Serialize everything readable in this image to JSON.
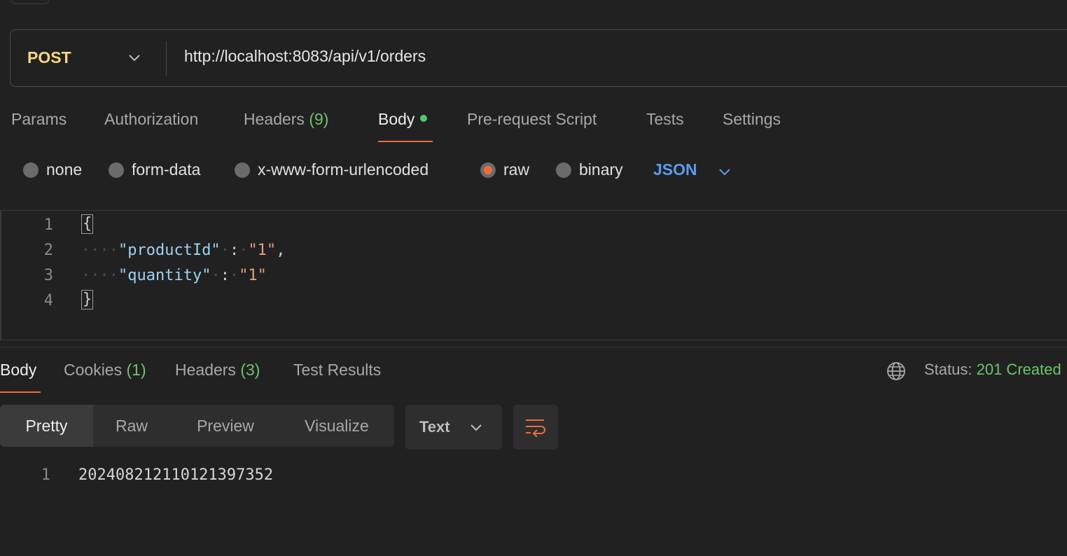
{
  "request": {
    "method": "POST",
    "url": "http://localhost:8083/api/v1/orders"
  },
  "request_tabs": [
    {
      "label": "Params"
    },
    {
      "label": "Authorization"
    },
    {
      "label": "Headers",
      "count": "(9)"
    },
    {
      "label": "Body",
      "active": true
    },
    {
      "label": "Pre-request Script"
    },
    {
      "label": "Tests"
    },
    {
      "label": "Settings"
    }
  ],
  "body_types": {
    "none": "none",
    "form_data": "form-data",
    "urlencoded": "x-www-form-urlencoded",
    "raw": "raw",
    "binary": "binary",
    "selected": "raw",
    "format": "JSON"
  },
  "editor": {
    "line_numbers": [
      "1",
      "2",
      "3",
      "4"
    ],
    "open_brace": "{",
    "close_brace": "}",
    "line2_key": "\"productId\"",
    "line2_colon": ":",
    "line2_value": "\"1\"",
    "line2_comma": ",",
    "line3_key": "\"quantity\"",
    "line3_colon": ":",
    "line3_value": "\"1\""
  },
  "response_tabs": {
    "body": "Body",
    "cookies": "Cookies",
    "cookies_count": "(1)",
    "headers": "Headers",
    "headers_count": "(3)",
    "test_results": "Test Results"
  },
  "status": {
    "label": "Status:",
    "value": "201 Created"
  },
  "view_modes": {
    "pretty": "Pretty",
    "raw": "Raw",
    "preview": "Preview",
    "visualize": "Visualize",
    "selected": "Pretty"
  },
  "response_format": "Text",
  "response_body": {
    "line_number": "1",
    "value": "20240821211012139735​2"
  },
  "colors": {
    "accent": "#f26b3a",
    "method": "#f5d783",
    "success": "#6cc36c",
    "link": "#5a9cf0"
  }
}
